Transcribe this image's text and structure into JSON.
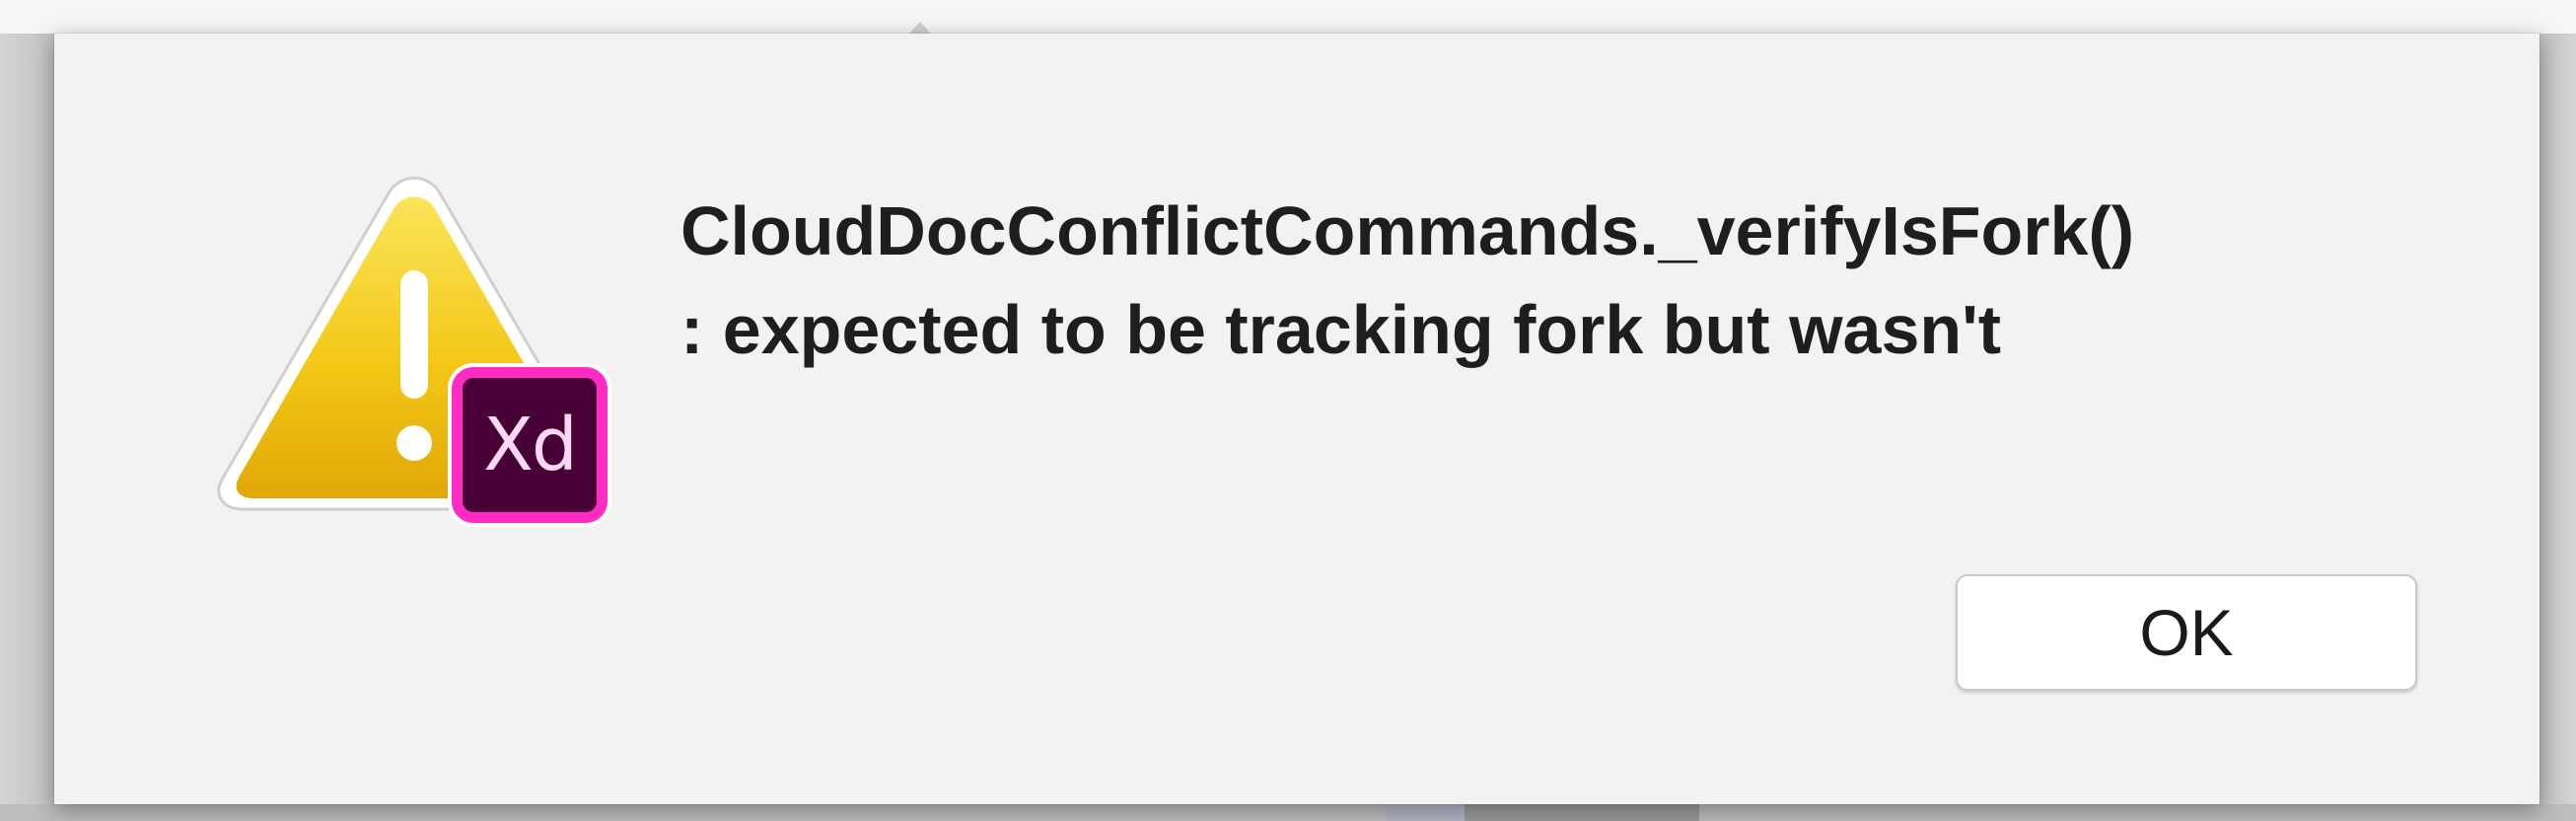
{
  "dialog": {
    "message_line_1": "CloudDocConflictCommands._verifyIsFork()",
    "message_line_2": ": expected to be tracking fork but wasn't",
    "ok_label": "OK",
    "icon": "warning-triangle-icon",
    "app_badge": {
      "icon": "adobe-xd-icon",
      "text": "Xd"
    }
  },
  "colors": {
    "dialog_background": "#f2f2f2",
    "warning_yellow": "#f2c40c",
    "xd_badge_background": "#470137",
    "xd_badge_border": "#ff2bc2",
    "xd_badge_text": "#ffd9f4"
  }
}
